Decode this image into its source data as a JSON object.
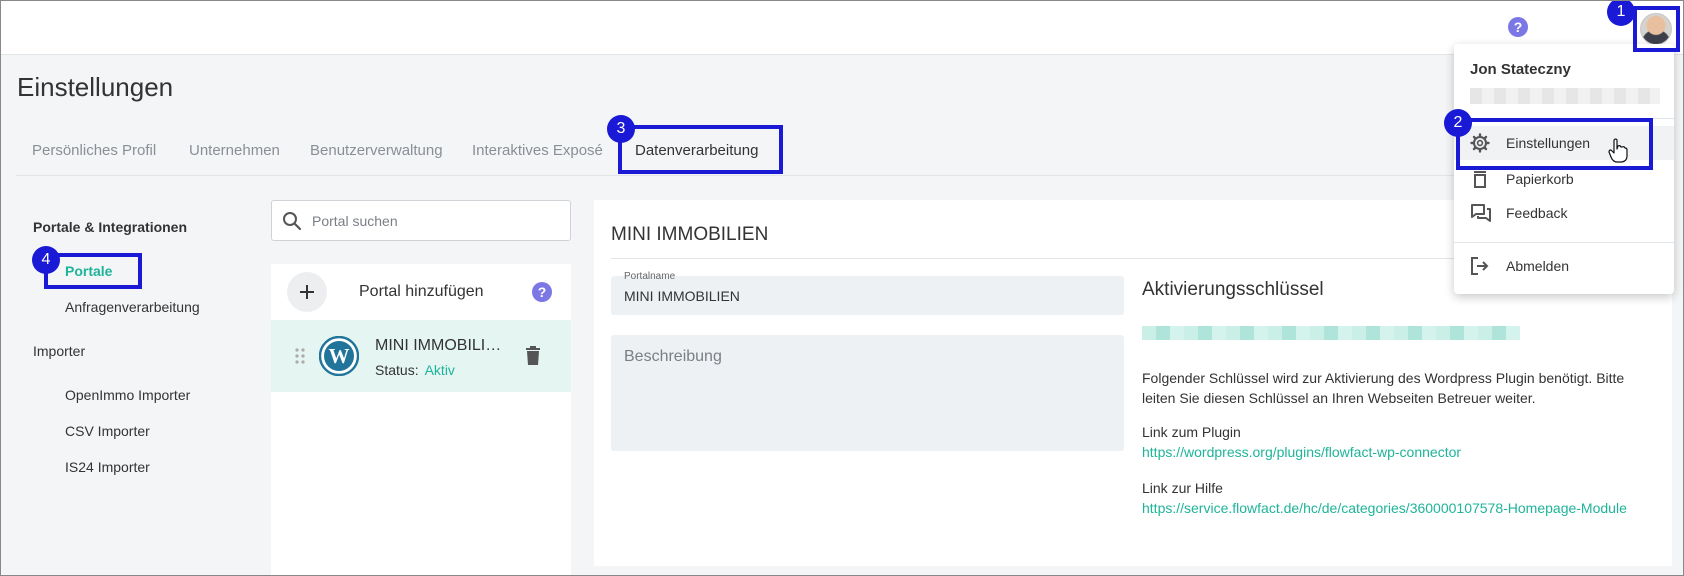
{
  "header": {
    "help_symbol": "?",
    "avatar_alt": "Jon Stateczny"
  },
  "page": {
    "title": "Einstellungen"
  },
  "tabs": [
    {
      "label": "Persönliches Profil"
    },
    {
      "label": "Unternehmen"
    },
    {
      "label": "Benutzerverwaltung"
    },
    {
      "label": "Interaktives Exposé"
    },
    {
      "label": "Datenverarbeitung"
    }
  ],
  "sidebar": {
    "section1": "Portale & Integrationen",
    "items1": [
      "Portale",
      "Anfragenverarbeitung"
    ],
    "section2": "Importer",
    "items2": [
      "OpenImmo Importer",
      "CSV Importer",
      "IS24 Importer"
    ]
  },
  "search": {
    "placeholder": "Portal suchen"
  },
  "portal_list": {
    "add_label": "Portal hinzufügen",
    "help_symbol": "?",
    "items": [
      {
        "name": "MINI IMMOBILIEN",
        "status_label": "Status:",
        "status_value": "Aktiv"
      }
    ]
  },
  "detail": {
    "title": "MINI IMMOBILIEN",
    "portalname_label": "Portalname",
    "portalname_value": "MINI IMMOBILIEN",
    "description_placeholder": "Beschreibung",
    "activation_title": "Aktivierungsschlüssel",
    "info_text": "Folgender Schlüssel wird zur Aktivierung des Wordpress Plugin benötigt. Bitte leiten Sie diesen Schlüssel an Ihren Webseiten Betreuer weiter.",
    "plugin_label": "Link zum Plugin",
    "plugin_url": "https://wordpress.org/plugins/flowfact-wp-connector",
    "help_label": "Link zur Hilfe",
    "help_url": "https://service.flowfact.de/hc/de/categories/360000107578-Homepage-Module"
  },
  "user_menu": {
    "name": "Jon Stateczny",
    "items": [
      "Einstellungen",
      "Papierkorb",
      "Feedback"
    ],
    "logout": "Abmelden"
  },
  "annotations": [
    "1",
    "2",
    "3",
    "4"
  ],
  "colors": {
    "accent": "#1fb49a",
    "annotation": "#1a19d6",
    "help": "#7b78e6"
  }
}
